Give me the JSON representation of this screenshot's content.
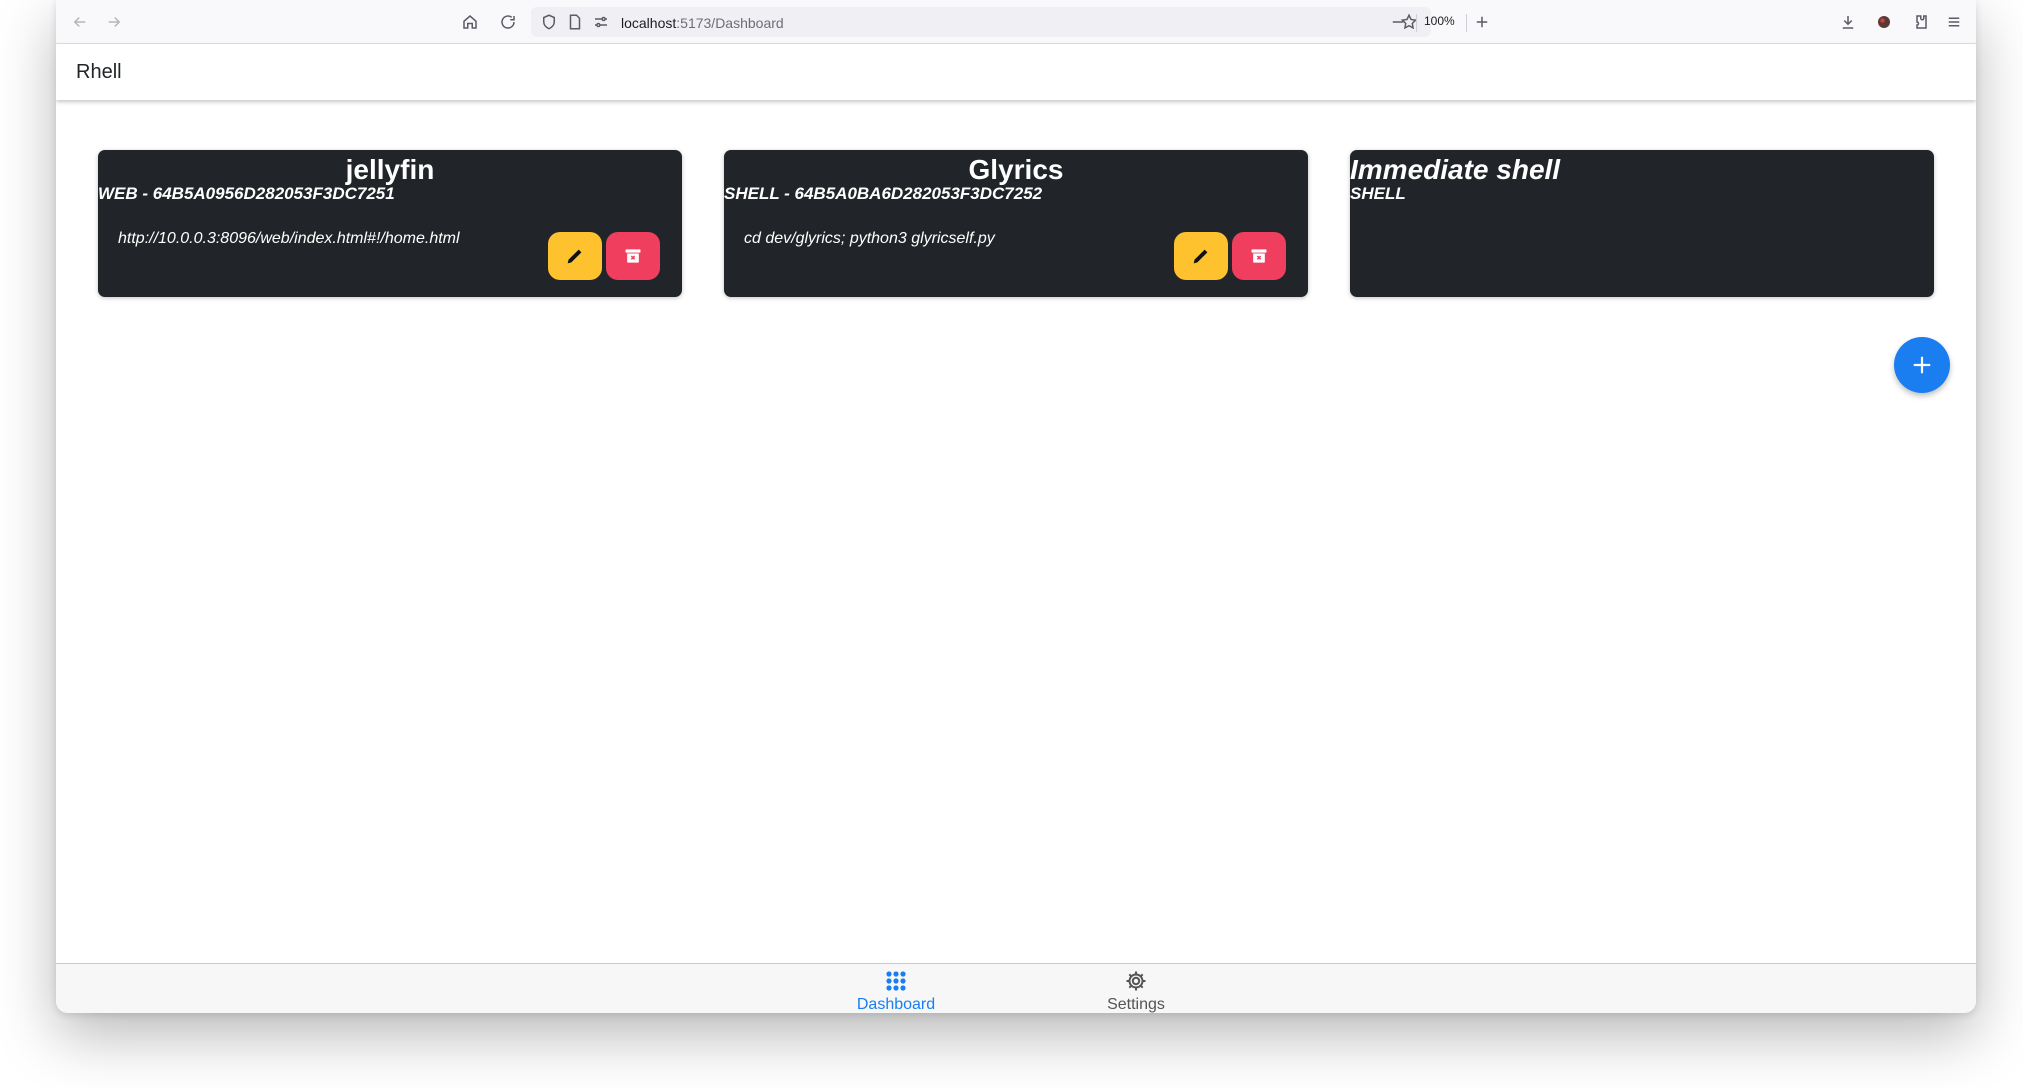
{
  "browser": {
    "url_host": "localhost",
    "url_rest": ":5173/Dashboard",
    "zoom": "100%"
  },
  "app": {
    "title": "Rhell"
  },
  "cards": [
    {
      "title": "jellyfin",
      "subtitle": "WEB - 64B5A0956D282053F3DC7251",
      "body": "http://10.0.0.3:8096/web/index.html#!/home.html"
    },
    {
      "title": "Glyrics",
      "subtitle": "SHELL - 64B5A0BA6D282053F3DC7252",
      "body": "cd dev/glyrics; python3 glyricself.py"
    },
    {
      "title": "Immediate shell",
      "subtitle": "SHELL"
    }
  ],
  "nav": {
    "dashboard_label": "Dashboard",
    "settings_label": "Settings"
  },
  "colors": {
    "card_bg": "#212529",
    "edit": "#fec22f",
    "delete": "#f03f5e",
    "accent": "#1a7ef0"
  },
  "icons": {
    "back": "back-arrow-icon",
    "forward": "forward-arrow-icon",
    "home": "home-icon",
    "reload": "reload-icon",
    "edit": "pencil-icon",
    "delete": "archive-delete-icon",
    "add": "plus-icon",
    "dashboard": "grid-dots-icon",
    "settings": "gear-icon"
  }
}
